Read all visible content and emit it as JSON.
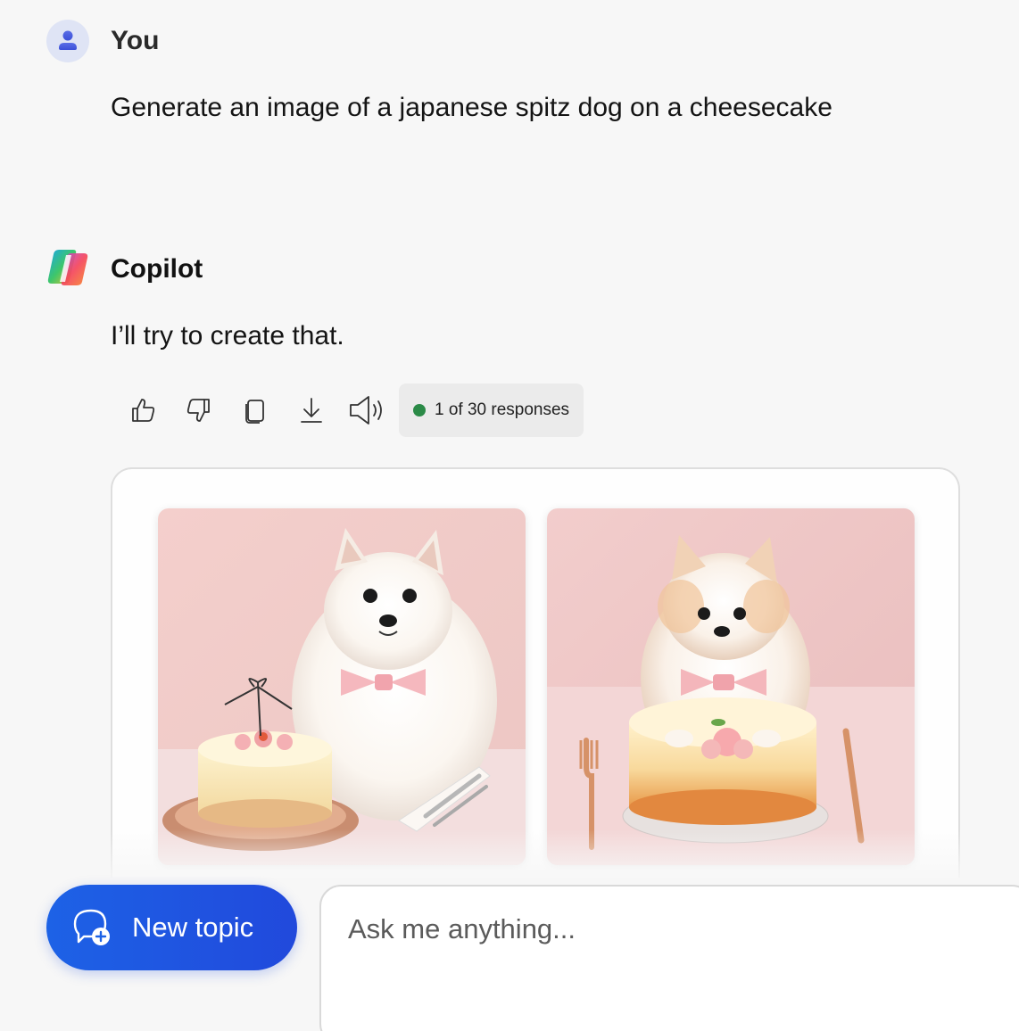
{
  "user": {
    "name": "You",
    "message": "Generate an image of a japanese spitz dog on a cheesecake"
  },
  "copilot": {
    "name": "Copilot",
    "message": "I’ll try to create that.",
    "actions": [
      "thumbs-up-icon",
      "thumbs-down-icon",
      "copy-icon",
      "download-icon",
      "speaker-icon"
    ],
    "responses_label": "1 of 30 responses",
    "status_color": "#2b8a47"
  },
  "images": [
    {
      "subject": "white spitz with pink bow beside cheesecake"
    },
    {
      "subject": "cream spitz on cheesecake with rose"
    }
  ],
  "bottom_bar": {
    "new_topic_label": "New topic",
    "input_placeholder": "Ask me anything..."
  },
  "colors": {
    "background": "#f7f7f7",
    "accent": "#1d62e6"
  }
}
